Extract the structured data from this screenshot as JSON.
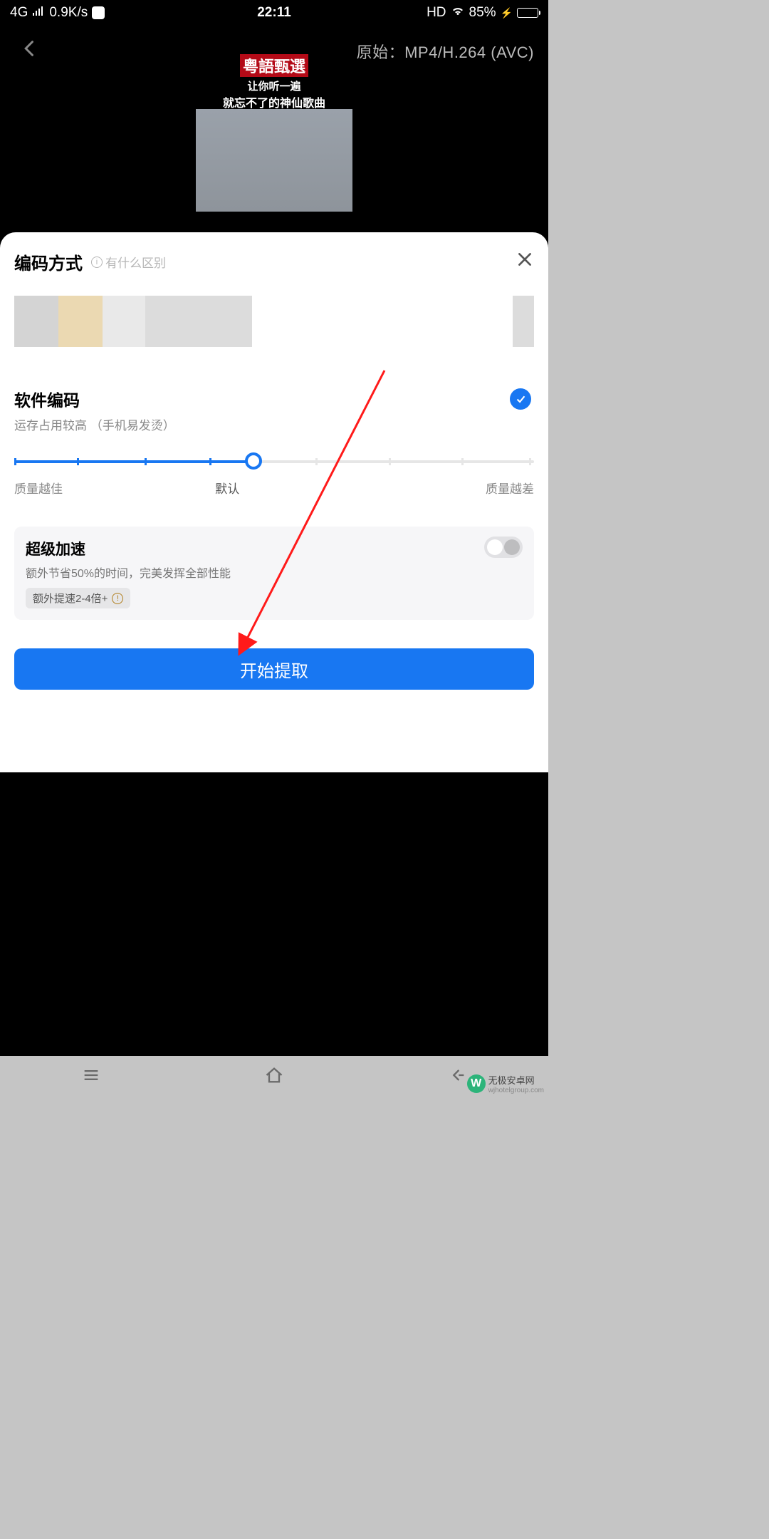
{
  "statusbar": {
    "network": "4G",
    "speed": "0.9K/s",
    "time": "22:11",
    "hd": "HD",
    "battery_pct": "85%"
  },
  "preview": {
    "original_label": "原始：",
    "original_value": "MP4/H.264 (AVC)",
    "thumb_title": "粤語甄選",
    "thumb_sub1": "让你听一遍",
    "thumb_sub2": "就忘不了的神仙歌曲"
  },
  "sheet": {
    "title": "编码方式",
    "hint": "有什么区别",
    "option": {
      "title": "软件编码",
      "sub": "运存占用较高 （手机易发烫）"
    },
    "slider": {
      "left": "质量越佳",
      "center": "默认",
      "right": "质量越差"
    },
    "accel": {
      "title": "超级加速",
      "sub": "额外节省50%的时间，完美发挥全部性能",
      "badge": "额外提速2-4倍+"
    },
    "start": "开始提取"
  },
  "watermark": {
    "text": "无极安卓网",
    "sub": "wjhotelgroup.com",
    "logo": "W"
  }
}
